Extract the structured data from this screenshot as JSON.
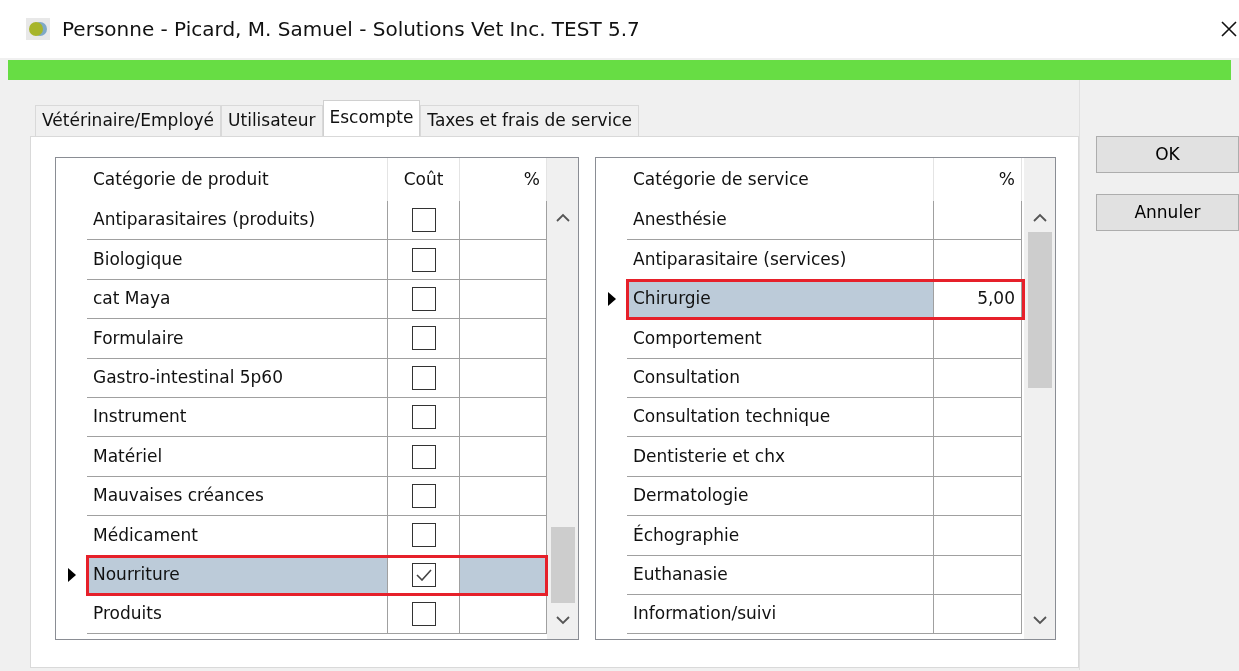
{
  "window": {
    "title": "Personne - Picard, M. Samuel - Solutions Vet Inc. TEST 5.7"
  },
  "tabs": [
    {
      "label": "Vétérinaire/Employé",
      "selected": false
    },
    {
      "label": "Utilisateur",
      "selected": false
    },
    {
      "label": "Escompte",
      "selected": true
    },
    {
      "label": "Taxes et frais de service",
      "selected": false
    }
  ],
  "product_grid": {
    "columns": [
      "Catégorie de produit",
      "Coût",
      "%"
    ],
    "rows": [
      {
        "category": "Antiparasitaires (produits)",
        "cost_checked": false,
        "selected": false,
        "highlighted": false
      },
      {
        "category": "Biologique",
        "cost_checked": false,
        "selected": false,
        "highlighted": false
      },
      {
        "category": "cat Maya",
        "cost_checked": false,
        "selected": false,
        "highlighted": false
      },
      {
        "category": "Formulaire",
        "cost_checked": false,
        "selected": false,
        "highlighted": false
      },
      {
        "category": "Gastro-intestinal 5p60",
        "cost_checked": false,
        "selected": false,
        "highlighted": false
      },
      {
        "category": "Instrument",
        "cost_checked": false,
        "selected": false,
        "highlighted": false
      },
      {
        "category": "Matériel",
        "cost_checked": false,
        "selected": false,
        "highlighted": false
      },
      {
        "category": "Mauvaises créances",
        "cost_checked": false,
        "selected": false,
        "highlighted": false
      },
      {
        "category": "Médicament",
        "cost_checked": false,
        "selected": false,
        "highlighted": false
      },
      {
        "category": "Nourriture",
        "cost_checked": true,
        "selected": true,
        "highlighted": true
      },
      {
        "category": "Produits",
        "cost_checked": false,
        "selected": false,
        "highlighted": false
      }
    ]
  },
  "service_grid": {
    "columns": [
      "Catégorie de service",
      "%"
    ],
    "rows": [
      {
        "category": "Anesthésie",
        "selected": false,
        "highlighted": false
      },
      {
        "category": "Antiparasitaire (services)",
        "selected": false,
        "highlighted": false
      },
      {
        "category": "Chirurgie",
        "percent": "5,00",
        "selected": true,
        "highlighted": true
      },
      {
        "category": "Comportement",
        "selected": false,
        "highlighted": false
      },
      {
        "category": "Consultation",
        "selected": false,
        "highlighted": false
      },
      {
        "category": "Consultation technique",
        "selected": false,
        "highlighted": false
      },
      {
        "category": "Dentisterie et chx",
        "selected": false,
        "highlighted": false
      },
      {
        "category": "Dermatologie",
        "selected": false,
        "highlighted": false
      },
      {
        "category": "Échographie",
        "selected": false,
        "highlighted": false
      },
      {
        "category": "Euthanasie",
        "selected": false,
        "highlighted": false
      },
      {
        "category": "Information/suivi",
        "selected": false,
        "highlighted": false
      }
    ]
  },
  "buttons": [
    "OK",
    "Annuler"
  ]
}
